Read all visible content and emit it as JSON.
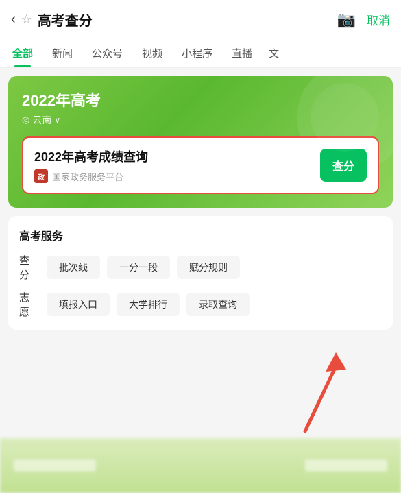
{
  "topBar": {
    "title": "高考查分",
    "cancelLabel": "取消",
    "backIcon": "‹",
    "starIcon": "☆"
  },
  "tabs": [
    {
      "label": "全部",
      "active": true
    },
    {
      "label": "新闻",
      "active": false
    },
    {
      "label": "公众号",
      "active": false
    },
    {
      "label": "视频",
      "active": false
    },
    {
      "label": "小程序",
      "active": false
    },
    {
      "label": "直播",
      "active": false
    },
    {
      "label": "文",
      "active": false
    }
  ],
  "greenCard": {
    "title": "2022年高考",
    "location": "云南",
    "locationIcon": "◎"
  },
  "resultBox": {
    "title": "2022年高考成绩查询",
    "source": "国家政务服务平台",
    "sourceLogoText": "政",
    "queryButtonLabel": "查分"
  },
  "services": {
    "title": "高考服务",
    "rows": [
      {
        "label": "查分",
        "tags": [
          "批次线",
          "一分一段",
          "赋分规则"
        ]
      },
      {
        "label": "志愿",
        "tags": [
          "填报入口",
          "大学排行",
          "录取查询"
        ]
      }
    ]
  }
}
